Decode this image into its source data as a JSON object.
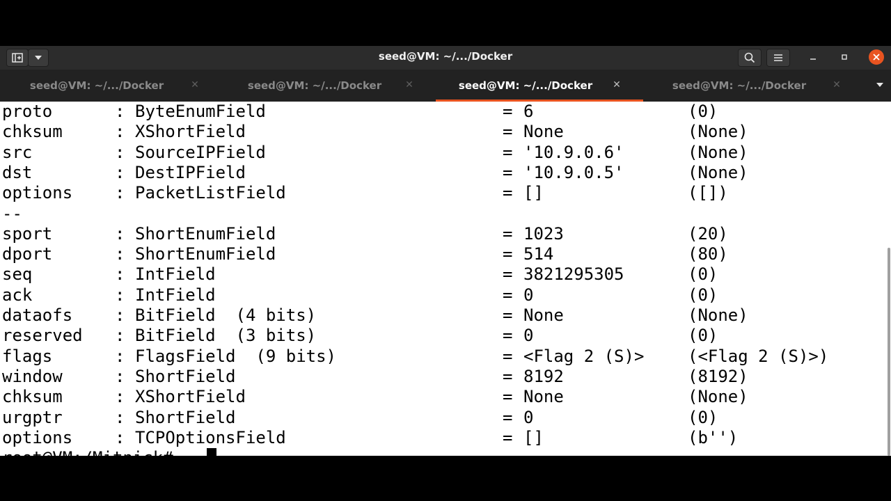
{
  "window": {
    "title": "seed@VM: ~/.../Docker",
    "new_tab_icon": "new-tab-icon",
    "search_icon": "search-icon",
    "menu_icon": "hamburger-menu-icon"
  },
  "tabs": [
    {
      "label": "seed@VM: ~/.../Docker",
      "active": false
    },
    {
      "label": "seed@VM: ~/.../Docker",
      "active": false
    },
    {
      "label": "seed@VM: ~/.../Docker",
      "active": true
    },
    {
      "label": "seed@VM: ~/.../Docker",
      "active": false
    }
  ],
  "colors": {
    "accent": "#e95420",
    "close_button": "#e95420",
    "titlebar": "#2c2c2c",
    "tabbar": "#222222",
    "terminal_bg": "#ffffff",
    "terminal_fg": "#000000"
  },
  "terminal": {
    "lines": [
      {
        "name": "proto",
        "colon": ":",
        "type": "ByteEnumField",
        "eq": "=",
        "value": "6",
        "default": "(0)"
      },
      {
        "name": "chksum",
        "colon": ":",
        "type": "XShortField",
        "eq": "=",
        "value": "None",
        "default": "(None)"
      },
      {
        "name": "src",
        "colon": ":",
        "type": "SourceIPField",
        "eq": "=",
        "value": "'10.9.0.6'",
        "default": "(None)"
      },
      {
        "name": "dst",
        "colon": ":",
        "type": "DestIPField",
        "eq": "=",
        "value": "'10.9.0.5'",
        "default": "(None)"
      },
      {
        "name": "options",
        "colon": ":",
        "type": "PacketListField",
        "eq": "=",
        "value": "[]",
        "default": "([])"
      },
      {
        "name": "--",
        "colon": "",
        "type": "",
        "eq": "",
        "value": "",
        "default": ""
      },
      {
        "name": "sport",
        "colon": ":",
        "type": "ShortEnumField",
        "eq": "=",
        "value": "1023",
        "default": "(20)"
      },
      {
        "name": "dport",
        "colon": ":",
        "type": "ShortEnumField",
        "eq": "=",
        "value": "514",
        "default": "(80)"
      },
      {
        "name": "seq",
        "colon": ":",
        "type": "IntField",
        "eq": "=",
        "value": "3821295305",
        "default": "(0)"
      },
      {
        "name": "ack",
        "colon": ":",
        "type": "IntField",
        "eq": "=",
        "value": "0",
        "default": "(0)"
      },
      {
        "name": "dataofs",
        "colon": ":",
        "type": "BitField  (4 bits)",
        "eq": "=",
        "value": "None",
        "default": "(None)"
      },
      {
        "name": "reserved",
        "colon": ":",
        "type": "BitField  (3 bits)",
        "eq": "=",
        "value": "0",
        "default": "(0)"
      },
      {
        "name": "flags",
        "colon": ":",
        "type": "FlagsField  (9 bits)",
        "eq": "=",
        "value": "<Flag 2 (S)>",
        "default": "(<Flag 2 (S)>)"
      },
      {
        "name": "window",
        "colon": ":",
        "type": "ShortField",
        "eq": "=",
        "value": "8192",
        "default": "(8192)"
      },
      {
        "name": "chksum",
        "colon": ":",
        "type": "XShortField",
        "eq": "=",
        "value": "None",
        "default": "(None)"
      },
      {
        "name": "urgptr",
        "colon": ":",
        "type": "ShortField",
        "eq": "=",
        "value": "0",
        "default": "(0)"
      },
      {
        "name": "options",
        "colon": ":",
        "type": "TCPOptionsField",
        "eq": "=",
        "value": "[]",
        "default": "(b'')"
      }
    ],
    "prompt": "root@VM:/Mitnick# "
  }
}
